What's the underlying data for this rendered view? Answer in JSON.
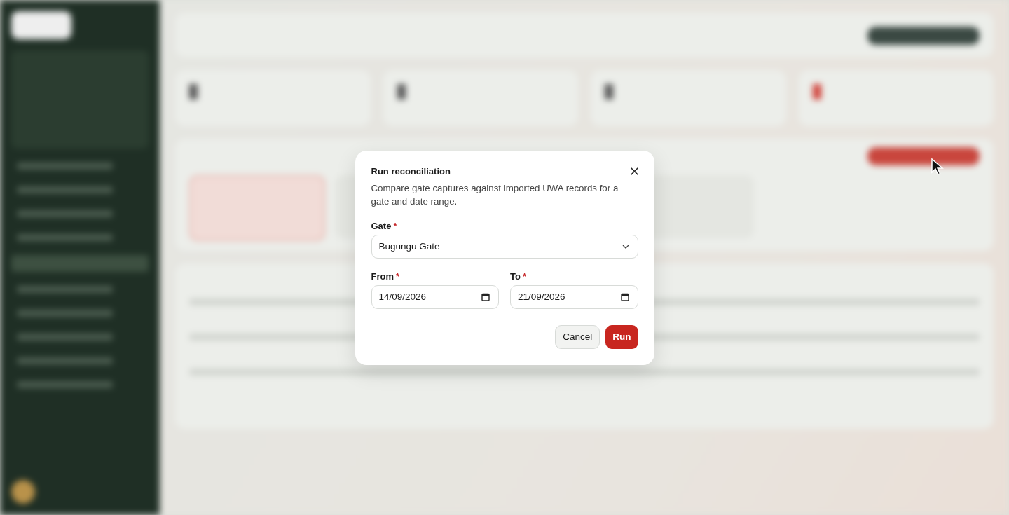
{
  "dialog": {
    "title": "Run reconciliation",
    "description": "Compare gate captures against imported UWA records for a gate and date range.",
    "fields": [
      {
        "kind": "select",
        "label": "Gate",
        "required_mark": "*",
        "value": "Bugungu Gate"
      },
      {
        "kind": "date",
        "label": "From",
        "required_mark": "*",
        "value": "14/09/2026"
      },
      {
        "kind": "date",
        "label": "To",
        "required_mark": "*",
        "value": "21/09/2026"
      }
    ],
    "buttons": [
      {
        "kind": "secondary",
        "label": "Cancel"
      },
      {
        "kind": "primary",
        "label": "Run"
      }
    ]
  }
}
